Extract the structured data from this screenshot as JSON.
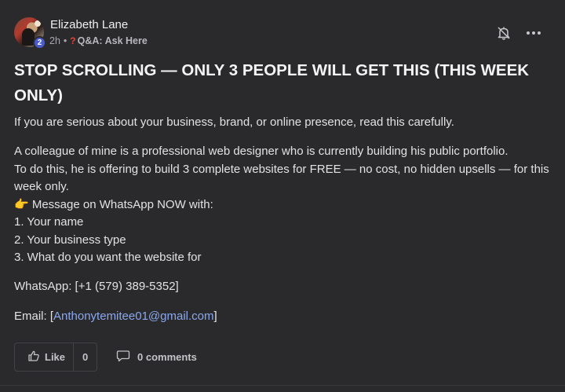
{
  "author": {
    "name": "Elizabeth Lane",
    "level": "2",
    "time": "2h",
    "separator": "•",
    "category_icon": "question-mark-icon",
    "category_glyph": "?",
    "category": "Q&A: Ask Here"
  },
  "post": {
    "title": "STOP SCROLLING — ONLY 3 PEOPLE WILL GET THIS (THIS WEEK ONLY)",
    "intro": "If you are serious about your business, brand, or online presence, read this carefully.",
    "lines": [
      "A colleague of mine is a professional web designer who is currently building his public portfolio.",
      "To do this, he is offering to build 3 complete websites for FREE — no cost, no hidden upsells — for this week only.",
      "👉 Message on WhatsApp NOW with:",
      "1. Your name",
      "2. Your business type",
      "3. What do you want the website for"
    ],
    "whatsapp": "WhatsApp: [+1 (579) 389-5352]",
    "email_prefix": "Email: [",
    "email_link": "Anthonytemitee01@gmail.com",
    "email_suffix": "]"
  },
  "actions": {
    "like_label": "Like",
    "like_count": "0",
    "comments_label": "0 comments"
  },
  "icons": {
    "bell": "bell-off-icon",
    "more": "more-horizontal-icon",
    "like": "thumbs-up-icon",
    "comment": "comment-bubble-icon"
  },
  "colors": {
    "background": "#2a2a2c",
    "link": "#8aa8ee",
    "badge": "#4a5ccc",
    "category_icon": "#e0453a"
  }
}
